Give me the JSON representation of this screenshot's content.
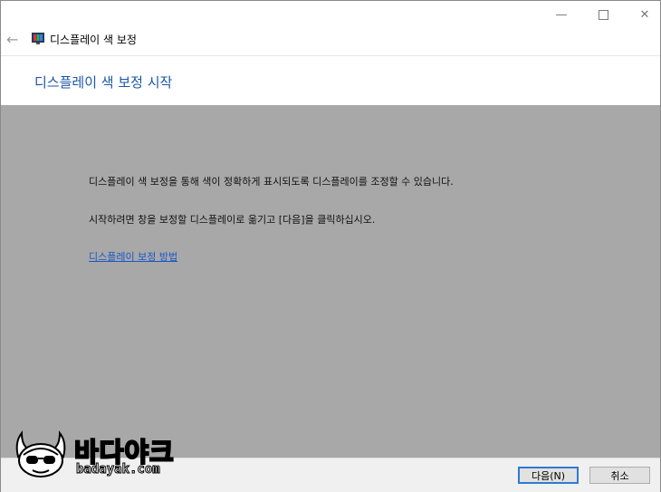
{
  "window": {
    "caption_buttons": {
      "minimize": "—",
      "close": "✕"
    }
  },
  "nav": {
    "back_glyph": "←",
    "app_title": "디스플레이 색 보정",
    "app_icon": "monitor-icon"
  },
  "header": {
    "heading": "디스플레이 색 보정 시작"
  },
  "content": {
    "line1": "디스플레이 색 보정을 통해 색이 정확하게 표시되도록 디스플레이를 조정할 수 있습니다.",
    "line2": "시작하려면 창을 보정할 디스플레이로 옮기고 [다음]을 클릭하십시오.",
    "link": "디스플레이 보정 방법"
  },
  "footer": {
    "next_label": "다음(N)",
    "cancel_label": "취소"
  },
  "watermark": {
    "title": "바다야크",
    "url": "badayak.com"
  },
  "colors": {
    "heading": "#1a57a8",
    "content_bg": "#a8a8a8",
    "link": "#1a57c8",
    "default_button_border": "#2f7ad1"
  }
}
